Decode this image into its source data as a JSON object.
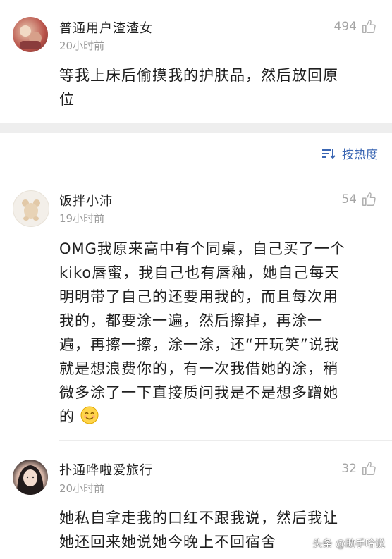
{
  "comments": [
    {
      "username": "普通用户渣渣女",
      "time": "20小时前",
      "likes": "494",
      "lines": [
        "等我上床后偷摸我的护肤品，然后放回原",
        "位"
      ]
    },
    {
      "username": "饭拌小沛",
      "time": "19小时前",
      "likes": "54",
      "lines": [
        "OMG我原来高中有个同桌，自己买了一个",
        "kiko唇蜜，我自己也有唇釉，她自己每天",
        "明明带了自己的还要用我的，而且每次用",
        "我的，都要涂一遍，然后擦掉，再涂一",
        "遍，再擦一擦，涂一涂，还“开玩笑”说我",
        "就是想浪费你的，有一次我借她的涂，稍",
        "微多涂了一下直接质问我是不是想多蹭她",
        "的"
      ],
      "emoji": "smiling-face-emoji"
    },
    {
      "username": "扑通哗啦爱旅行",
      "time": "20小时前",
      "likes": "32",
      "lines": [
        "她私自拿走我的口红不跟我说，然后我让",
        "她还回来她说她今晚上不回宿舍"
      ]
    }
  ],
  "sort": {
    "label": "按热度",
    "icon": "sort-icon"
  },
  "watermark": "头条 @助手哈说",
  "colors": {
    "accent": "#3a66b3",
    "muted": "#9a9a9a",
    "separator": "#eeeeee"
  }
}
